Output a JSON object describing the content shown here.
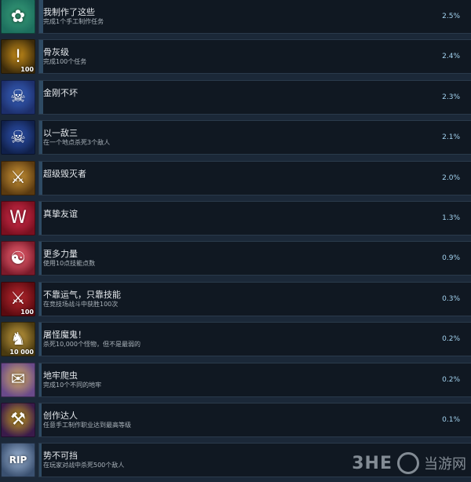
{
  "achievements": [
    {
      "title": "我制作了这些",
      "desc": "完成1个手工制作任务",
      "pct": "2.5%",
      "icon": "crafting-icon",
      "colors": [
        "#1d6f5e",
        "#39a07a"
      ],
      "glyph": "✿",
      "badge": "",
      "progress": 0.025
    },
    {
      "title": "骨灰级",
      "desc": "完成100个任务",
      "pct": "2.4%",
      "icon": "exclamation-icon",
      "colors": [
        "#3b2a0a",
        "#c98f1a"
      ],
      "glyph": "!",
      "badge": "100",
      "progress": 0.024
    },
    {
      "title": "金刚不坏",
      "desc": "",
      "pct": "2.3%",
      "icon": "skull-crossbones-icon",
      "colors": [
        "#1d2f6b",
        "#3a66c7"
      ],
      "glyph": "☠",
      "badge": "",
      "progress": 0.023
    },
    {
      "title": "以一敌三",
      "desc": "在一个地点杀死3个敌人",
      "pct": "2.1%",
      "icon": "three-skulls-icon",
      "colors": [
        "#10204a",
        "#3056b8"
      ],
      "glyph": "☠",
      "badge": "",
      "progress": 0.021
    },
    {
      "title": "超级毁灭者",
      "desc": "",
      "pct": "2.0%",
      "icon": "weapons-icon",
      "colors": [
        "#5a3a10",
        "#d29a3a"
      ],
      "glyph": "⚔",
      "badge": "",
      "progress": 0.02
    },
    {
      "title": "真挚友谊",
      "desc": "",
      "pct": "1.3%",
      "icon": "w-emblem-icon",
      "colors": [
        "#7a1020",
        "#e03050"
      ],
      "glyph": "W",
      "badge": "",
      "progress": 0.013
    },
    {
      "title": "更多力量",
      "desc": "使用10点技能点数",
      "pct": "0.9%",
      "icon": "meditation-icon",
      "colors": [
        "#7a1a2a",
        "#ff6a7a"
      ],
      "glyph": "☯",
      "badge": "",
      "progress": 0.009
    },
    {
      "title": "不靠运气，只靠技能",
      "desc": "在竞技场战斗中获胜100次",
      "pct": "0.3%",
      "icon": "arena-sword-icon",
      "colors": [
        "#5a0a10",
        "#c02a30"
      ],
      "glyph": "⚔",
      "badge": "100",
      "progress": 0.003
    },
    {
      "title": "屠怪魔鬼！",
      "desc": "杀死10,000个怪物，但不是最弱的",
      "pct": "0.2%",
      "icon": "monster-head-icon",
      "colors": [
        "#4a3a10",
        "#c8a040"
      ],
      "glyph": "♞",
      "badge": "10 000",
      "progress": 0.002
    },
    {
      "title": "地牢爬虫",
      "desc": "完成10个不同的地牢",
      "pct": "0.2%",
      "icon": "scroll-map-icon",
      "colors": [
        "#6a4a8a",
        "#d8b060"
      ],
      "glyph": "✉",
      "badge": "",
      "progress": 0.002
    },
    {
      "title": "创作达人",
      "desc": "任意手工制作职业达到最高等级",
      "pct": "0.1%",
      "icon": "hammer-sword-icon",
      "colors": [
        "#3a1a4a",
        "#c8a020"
      ],
      "glyph": "⚒",
      "badge": "",
      "progress": 0.001
    },
    {
      "title": "势不可挡",
      "desc": "在玩家对战中杀死500个敌人",
      "pct": "",
      "icon": "rip-tombstone-icon",
      "colors": [
        "#3a5070",
        "#a0b8d8"
      ],
      "glyph": "RIP",
      "badge": "",
      "progress": 0.0
    }
  ],
  "watermark": {
    "brand": "3HE",
    "site": "当游网"
  }
}
